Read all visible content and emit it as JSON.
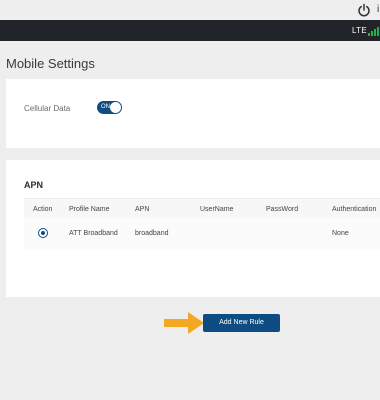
{
  "top_strip": {
    "power_icon": "power-icon",
    "partial_text": "i"
  },
  "status_bar": {
    "network": "LTE",
    "signal_icon": "signal-bars-icon",
    "signal_color": "#1fb34a"
  },
  "page": {
    "title": "Mobile Settings"
  },
  "cellular": {
    "label": "Cellular Data",
    "toggle_text": "ON",
    "toggle_color": "#0f4c81"
  },
  "apn": {
    "title": "APN",
    "columns": [
      "Action",
      "Profile Name",
      "APN",
      "UserName",
      "PassWord",
      "Authentication"
    ],
    "rows": [
      {
        "selected": true,
        "profile_name": "ATT Broadband",
        "apn": "broadband",
        "username": "",
        "password": "",
        "authentication": "None"
      }
    ]
  },
  "add_button": {
    "label": "Add New Rule",
    "color": "#0f4c81"
  },
  "callout": {
    "icon": "arrow-right-icon",
    "color": "#f5a623"
  }
}
